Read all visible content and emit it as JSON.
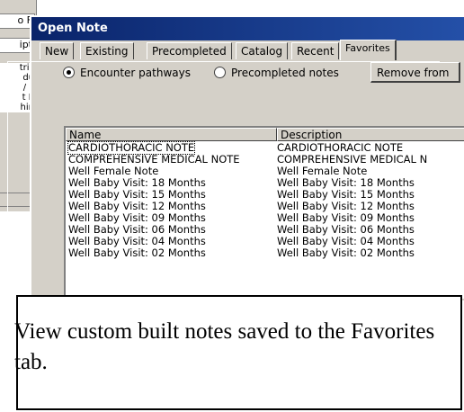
{
  "background_window": {
    "fragments": [
      "o F",
      "ipt"
    ],
    "list_lines": [
      "tric",
      "du",
      "/ F",
      "t E",
      "hin"
    ]
  },
  "dialog": {
    "title": "Open Note",
    "tabs": [
      {
        "label": "New"
      },
      {
        "label": "Existing"
      },
      {
        "label": "Precompleted"
      },
      {
        "label": "Catalog"
      },
      {
        "label": "Recent"
      },
      {
        "label": "Favorites",
        "active": true
      }
    ],
    "radio_options": [
      {
        "label": "Encounter pathways",
        "checked": true
      },
      {
        "label": "Precompleted notes",
        "checked": false
      }
    ],
    "remove_button": "Remove from",
    "columns": [
      "Name",
      "Description"
    ],
    "rows": [
      {
        "name": "CARDIOTHORACIC NOTE",
        "description": "CARDIOTHORACIC NOTE"
      },
      {
        "name": "COMPREHENSIVE MEDICAL NOTE",
        "description": "COMPREHENSIVE MEDICAL N"
      },
      {
        "name": "Well Female Note",
        "description": "Well Female Note"
      },
      {
        "name": "Well Baby Visit: 18 Months",
        "description": "Well Baby Visit: 18 Months"
      },
      {
        "name": "Well Baby Visit: 15 Months",
        "description": "Well Baby Visit: 15 Months"
      },
      {
        "name": "Well Baby Visit: 12 Months",
        "description": "Well Baby Visit: 12 Months"
      },
      {
        "name": "Well Baby Visit: 09 Months",
        "description": "Well Baby Visit: 09 Months"
      },
      {
        "name": "Well Baby Visit: 06 Months",
        "description": "Well Baby Visit: 06 Months"
      },
      {
        "name": "Well Baby Visit: 04 Months",
        "description": "Well Baby Visit: 04 Months"
      },
      {
        "name": "Well Baby Visit: 02 Months",
        "description": "Well Baby Visit: 02 Months"
      }
    ]
  },
  "caption": "View custom built notes saved to the Favorites tab.",
  "colors": {
    "titlebar": "#0a246a",
    "window_face": "#d4d0c8"
  }
}
